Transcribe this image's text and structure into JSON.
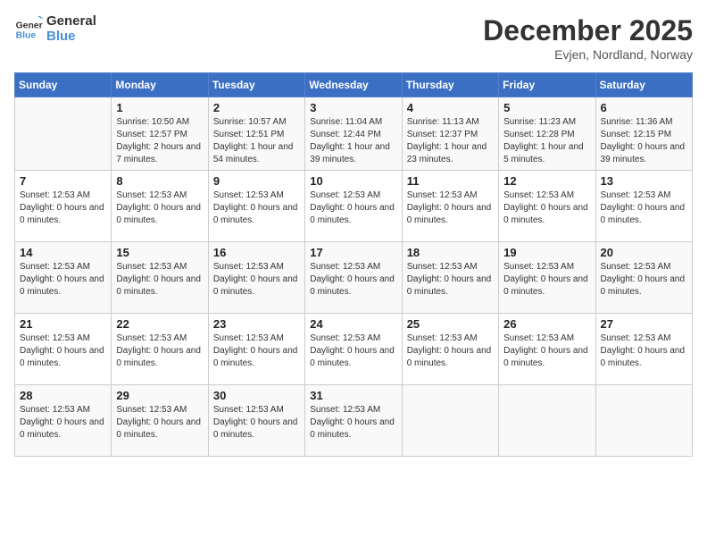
{
  "logo": {
    "line1": "General",
    "line2": "Blue"
  },
  "title": "December 2025",
  "location": "Evjen, Nordland, Norway",
  "days_of_week": [
    "Sunday",
    "Monday",
    "Tuesday",
    "Wednesday",
    "Thursday",
    "Friday",
    "Saturday"
  ],
  "weeks": [
    [
      {
        "day": "",
        "info": ""
      },
      {
        "day": "1",
        "info": "Sunrise: 10:50 AM\nSunset: 12:57 PM\nDaylight: 2 hours and 7 minutes."
      },
      {
        "day": "2",
        "info": "Sunrise: 10:57 AM\nSunset: 12:51 PM\nDaylight: 1 hour and 54 minutes."
      },
      {
        "day": "3",
        "info": "Sunrise: 11:04 AM\nSunset: 12:44 PM\nDaylight: 1 hour and 39 minutes."
      },
      {
        "day": "4",
        "info": "Sunrise: 11:13 AM\nSunset: 12:37 PM\nDaylight: 1 hour and 23 minutes."
      },
      {
        "day": "5",
        "info": "Sunrise: 11:23 AM\nSunset: 12:28 PM\nDaylight: 1 hour and 5 minutes."
      },
      {
        "day": "6",
        "info": "Sunrise: 11:36 AM\nSunset: 12:15 PM\nDaylight: 0 hours and 39 minutes."
      }
    ],
    [
      {
        "day": "7",
        "info": "Sunset: 12:53 AM\nDaylight: 0 hours and 0 minutes."
      },
      {
        "day": "8",
        "info": "Sunset: 12:53 AM\nDaylight: 0 hours and 0 minutes."
      },
      {
        "day": "9",
        "info": "Sunset: 12:53 AM\nDaylight: 0 hours and 0 minutes."
      },
      {
        "day": "10",
        "info": "Sunset: 12:53 AM\nDaylight: 0 hours and 0 minutes."
      },
      {
        "day": "11",
        "info": "Sunset: 12:53 AM\nDaylight: 0 hours and 0 minutes."
      },
      {
        "day": "12",
        "info": "Sunset: 12:53 AM\nDaylight: 0 hours and 0 minutes."
      },
      {
        "day": "13",
        "info": "Sunset: 12:53 AM\nDaylight: 0 hours and 0 minutes."
      }
    ],
    [
      {
        "day": "14",
        "info": "Sunset: 12:53 AM\nDaylight: 0 hours and 0 minutes."
      },
      {
        "day": "15",
        "info": "Sunset: 12:53 AM\nDaylight: 0 hours and 0 minutes."
      },
      {
        "day": "16",
        "info": "Sunset: 12:53 AM\nDaylight: 0 hours and 0 minutes."
      },
      {
        "day": "17",
        "info": "Sunset: 12:53 AM\nDaylight: 0 hours and 0 minutes."
      },
      {
        "day": "18",
        "info": "Sunset: 12:53 AM\nDaylight: 0 hours and 0 minutes."
      },
      {
        "day": "19",
        "info": "Sunset: 12:53 AM\nDaylight: 0 hours and 0 minutes."
      },
      {
        "day": "20",
        "info": "Sunset: 12:53 AM\nDaylight: 0 hours and 0 minutes."
      }
    ],
    [
      {
        "day": "21",
        "info": "Sunset: 12:53 AM\nDaylight: 0 hours and 0 minutes."
      },
      {
        "day": "22",
        "info": "Sunset: 12:53 AM\nDaylight: 0 hours and 0 minutes."
      },
      {
        "day": "23",
        "info": "Sunset: 12:53 AM\nDaylight: 0 hours and 0 minutes."
      },
      {
        "day": "24",
        "info": "Sunset: 12:53 AM\nDaylight: 0 hours and 0 minutes."
      },
      {
        "day": "25",
        "info": "Sunset: 12:53 AM\nDaylight: 0 hours and 0 minutes."
      },
      {
        "day": "26",
        "info": "Sunset: 12:53 AM\nDaylight: 0 hours and 0 minutes."
      },
      {
        "day": "27",
        "info": "Sunset: 12:53 AM\nDaylight: 0 hours and 0 minutes."
      }
    ],
    [
      {
        "day": "28",
        "info": "Sunset: 12:53 AM\nDaylight: 0 hours and 0 minutes."
      },
      {
        "day": "29",
        "info": "Sunset: 12:53 AM\nDaylight: 0 hours and 0 minutes."
      },
      {
        "day": "30",
        "info": "Sunset: 12:53 AM\nDaylight: 0 hours and 0 minutes."
      },
      {
        "day": "31",
        "info": "Sunset: 12:53 AM\nDaylight: 0 hours and 0 minutes."
      },
      {
        "day": "",
        "info": ""
      },
      {
        "day": "",
        "info": ""
      },
      {
        "day": "",
        "info": ""
      }
    ]
  ]
}
